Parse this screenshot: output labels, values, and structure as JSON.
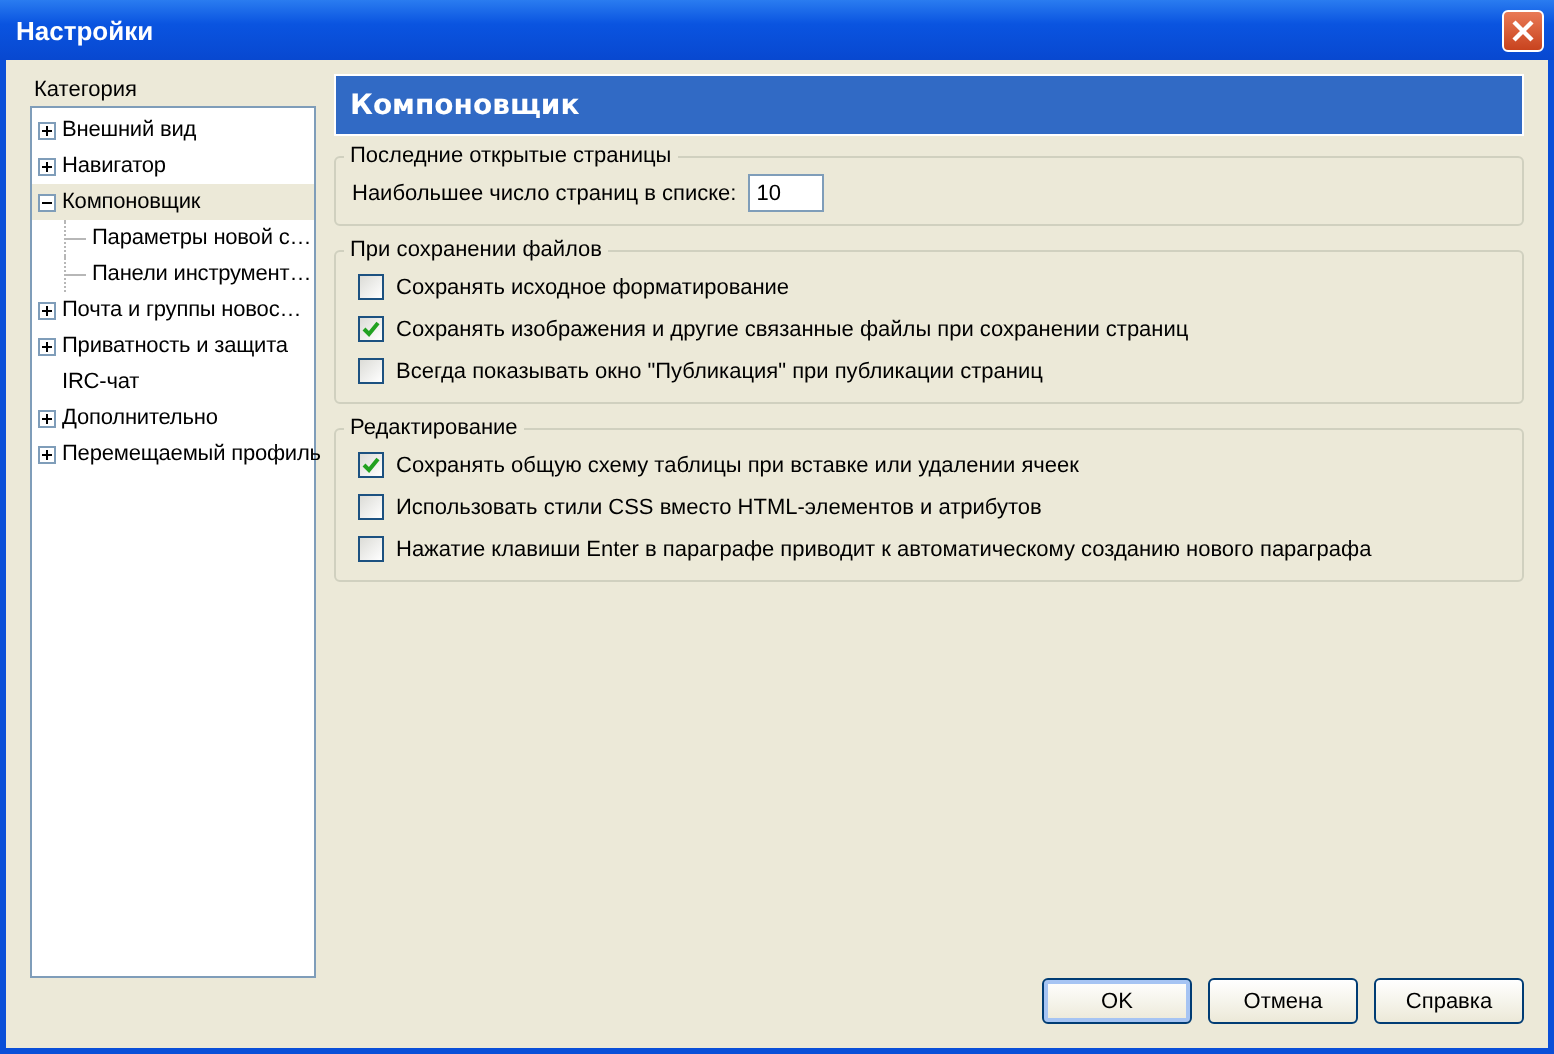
{
  "window": {
    "title": "Настройки"
  },
  "sidebar": {
    "label": "Категория",
    "items": [
      {
        "label": "Внешний вид",
        "kind": "group",
        "expanded": false,
        "selected": false
      },
      {
        "label": "Навигатор",
        "kind": "group",
        "expanded": false,
        "selected": false
      },
      {
        "label": "Компоновщик",
        "kind": "group",
        "expanded": true,
        "selected": true,
        "children": [
          {
            "label": "Параметры новой с…",
            "selected": false
          },
          {
            "label": "Панели инструмент…",
            "selected": false
          }
        ]
      },
      {
        "label": "Почта и группы новос…",
        "kind": "group",
        "expanded": false,
        "selected": false
      },
      {
        "label": "Приватность и защита",
        "kind": "group",
        "expanded": false,
        "selected": false
      },
      {
        "label": "IRC-чат",
        "kind": "leaf",
        "selected": false
      },
      {
        "label": "Дополнительно",
        "kind": "group",
        "expanded": false,
        "selected": false
      },
      {
        "label": "Перемещаемый профиль",
        "kind": "group",
        "expanded": false,
        "selected": false
      }
    ]
  },
  "panel": {
    "title": "Компоновщик",
    "groups": [
      {
        "title": "Последние открытые страницы",
        "rows": [
          {
            "kind": "field",
            "label": "Наибольшее число страниц в списке:",
            "value": "10"
          }
        ]
      },
      {
        "title": "При сохранении файлов",
        "rows": [
          {
            "kind": "checkbox",
            "label": "Сохранять исходное форматирование",
            "checked": false
          },
          {
            "kind": "checkbox",
            "label": "Сохранять изображения и другие связанные файлы при сохранении страниц",
            "checked": true
          },
          {
            "kind": "checkbox",
            "label": "Всегда показывать окно \"Публикация\" при публикации страниц",
            "checked": false
          }
        ]
      },
      {
        "title": "Редактирование",
        "rows": [
          {
            "kind": "checkbox",
            "label": "Сохранять общую схему таблицы при вставке или удалении ячеек",
            "checked": true
          },
          {
            "kind": "checkbox",
            "label": "Использовать стили CSS вместо HTML-элементов и атрибутов",
            "checked": false
          },
          {
            "kind": "checkbox",
            "label": "Нажатие клавиши Enter в параграфе приводит к автоматическому созданию нового параграфа",
            "checked": false
          }
        ]
      }
    ]
  },
  "buttons": [
    "OK",
    "Отмена",
    "Справка"
  ]
}
